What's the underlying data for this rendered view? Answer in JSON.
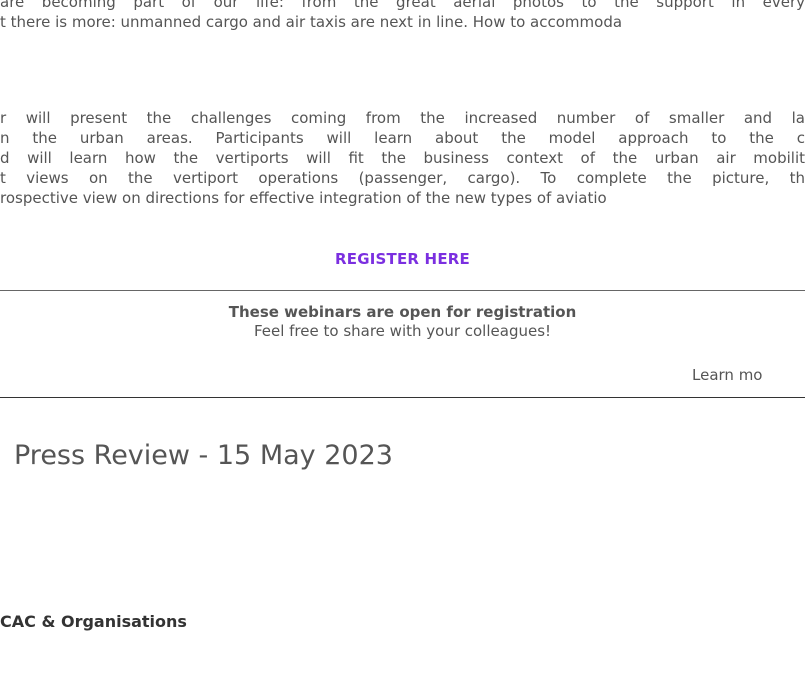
{
  "intro": {
    "lines": [
      "are becoming part of our life: from the great aerial photos to the support in every",
      "t there is more: unmanned cargo and air taxis are next in line. How to accommoda"
    ]
  },
  "description": {
    "lines": [
      "r will present the challenges coming from the increased number of smaller and la",
      "n the urban areas. Participants will learn about the model approach to the c",
      "d will learn how the vertiports will fit the business context of the urban air mobilit",
      "t views on the vertiport operations (passenger, cargo). To complete the picture, th",
      "rospective view on directions for effective integration of the new types of aviatio"
    ]
  },
  "register": {
    "label": "REGISTER HERE"
  },
  "notice": {
    "title": "These webinars are open for registration",
    "subtitle": "Feel free to share with your colleagues!"
  },
  "learn_more": {
    "label": "Learn mo"
  },
  "press_review": {
    "title": "Press Review - 15 May 2023"
  },
  "section": {
    "heading": "CAC & Organisations"
  },
  "colors": {
    "link": "#7b2fe0",
    "text": "#555555"
  }
}
